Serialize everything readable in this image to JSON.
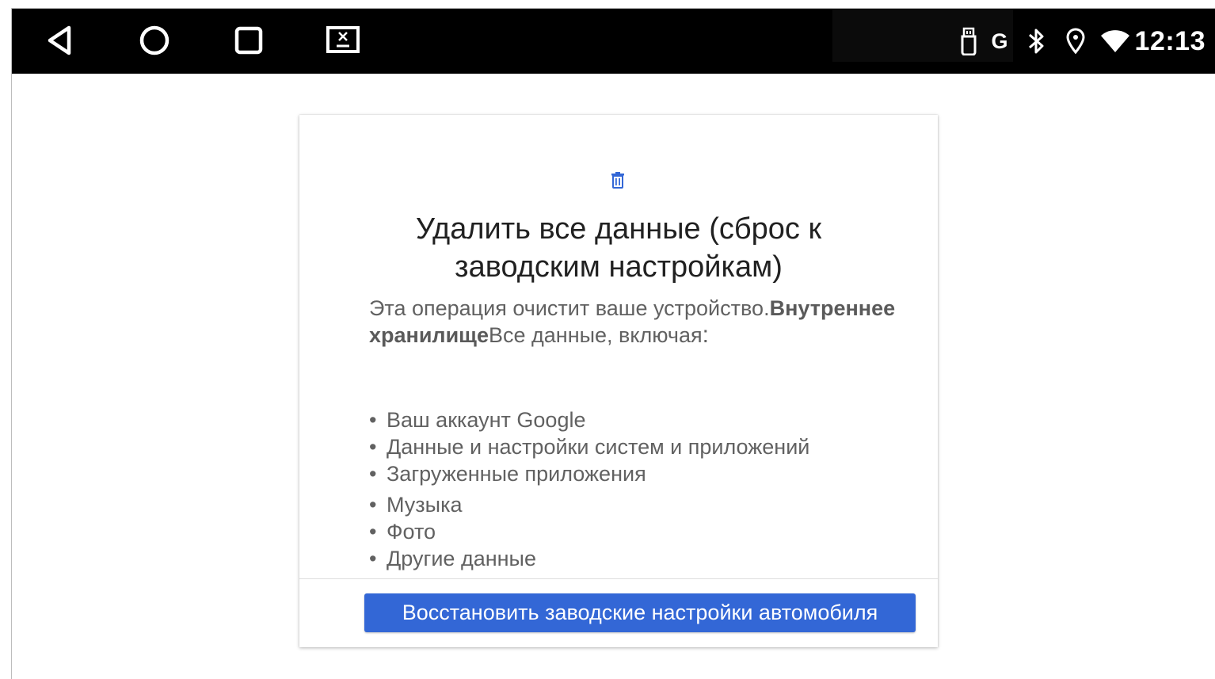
{
  "status_bar": {
    "time": "12:13",
    "carrier_letter": "G",
    "icons": [
      "usb-icon",
      "google-icon",
      "bluetooth-icon",
      "location-icon",
      "wifi-icon"
    ],
    "background": "#000000"
  },
  "nav_bar": {
    "buttons": [
      "back-icon",
      "home-icon",
      "recents-icon",
      "screen-off-icon"
    ]
  },
  "dialog": {
    "icon": "trash-icon",
    "icon_color": "#3367d6",
    "title": "Удалить все данные (сброс к заводским настройкам)",
    "body_part1": "Эта операция очистит ваше устройство.",
    "body_bold": "Внутреннее хранилище",
    "body_part2": "Все данные, включая",
    "body_colon": ":",
    "list_items": [
      "Ваш аккаунт Google",
      "Данные и настройки систем и приложений",
      "Загруженные приложения",
      "Музыка",
      "Фото",
      "Другие данные"
    ],
    "primary_button": "Восстановить заводские настройки автомобиля",
    "accent_color": "#3367d6"
  }
}
